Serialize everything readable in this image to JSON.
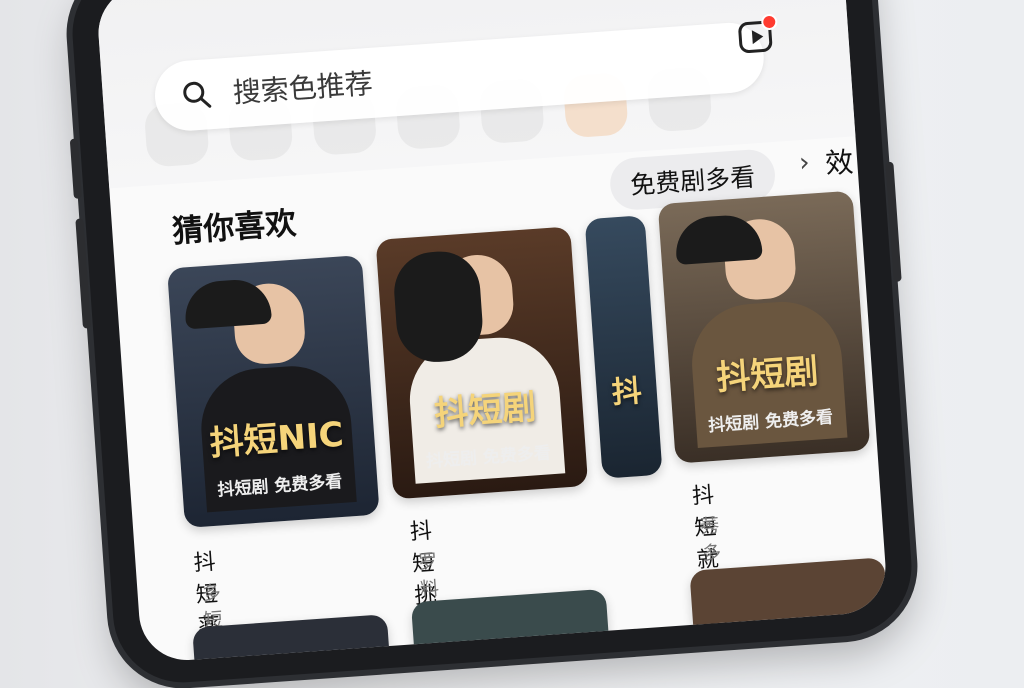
{
  "search": {
    "placeholder": "搜索色推荐"
  },
  "section": {
    "title": "猜你喜欢"
  },
  "chips": {
    "free": "免费剧多看",
    "more": "效"
  },
  "cards": [
    {
      "poster_title": "抖短NIC",
      "poster_sub": "抖短剧 免费多看",
      "title": "抖短薬",
      "sub": "多短菈"
    },
    {
      "poster_title": "抖短剧",
      "poster_sub": "抖短剧 免费多看",
      "title": "抖短挑 莰多杲",
      "sub": "罗 料脯"
    },
    {
      "poster_title": "抖",
      "poster_sub": "",
      "title": "",
      "sub": ""
    },
    {
      "poster_title": "抖短剧",
      "poster_sub": "抖短剧 免费多看",
      "title": "抖短就桑变",
      "sub": "莠多看"
    }
  ],
  "colors": {
    "accent_red": "#ff3b30",
    "poster_gold": "#f5d47a"
  }
}
